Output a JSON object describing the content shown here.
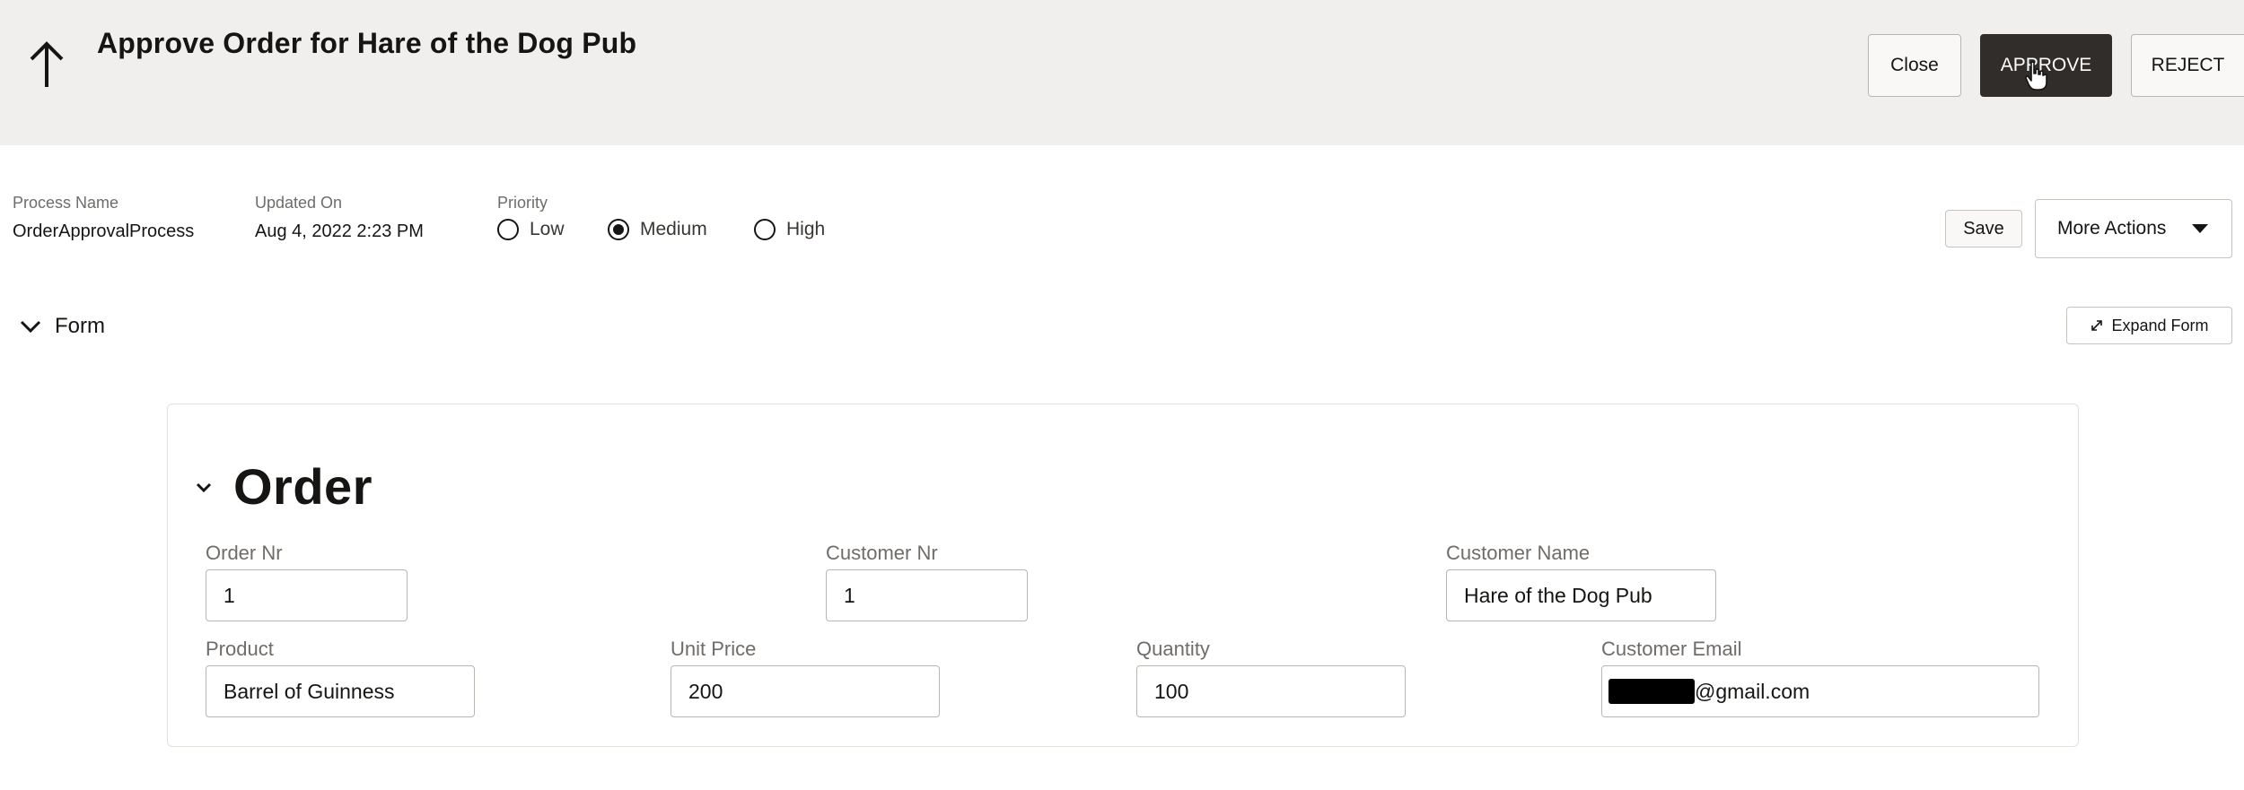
{
  "header": {
    "title": "Approve Order for Hare of the Dog Pub",
    "back_icon": "arrow-up-icon",
    "close_label": "Close",
    "approve_label": "APPROVE",
    "reject_label": "REJECT"
  },
  "details": {
    "process_name_label": "Process Name",
    "process_name_value": "OrderApprovalProcess",
    "updated_on_label": "Updated On",
    "updated_on_value": "Aug 4, 2022 2:23 PM",
    "priority_label": "Priority",
    "priority_options": [
      "Low",
      "Medium",
      "High"
    ],
    "priority_selected": "Medium",
    "save_label": "Save",
    "more_actions_label": "More Actions"
  },
  "form_section": {
    "label": "Form",
    "expand_label": "Expand Form"
  },
  "order": {
    "heading": "Order",
    "order_nr_label": "Order Nr",
    "order_nr_value": "1",
    "customer_nr_label": "Customer Nr",
    "customer_nr_value": "1",
    "customer_name_label": "Customer Name",
    "customer_name_value": "Hare of the Dog Pub",
    "product_label": "Product",
    "product_value": "Barrel of Guinness",
    "unit_price_label": "Unit Price",
    "unit_price_value": "200",
    "quantity_label": "Quantity",
    "quantity_value": "100",
    "customer_email_label": "Customer Email",
    "customer_email_visible": "@gmail.com"
  },
  "colors": {
    "header_bg": "#f1efed",
    "primary_button": "#312d2a",
    "text": "#161513",
    "muted_text": "#6f6c69"
  }
}
